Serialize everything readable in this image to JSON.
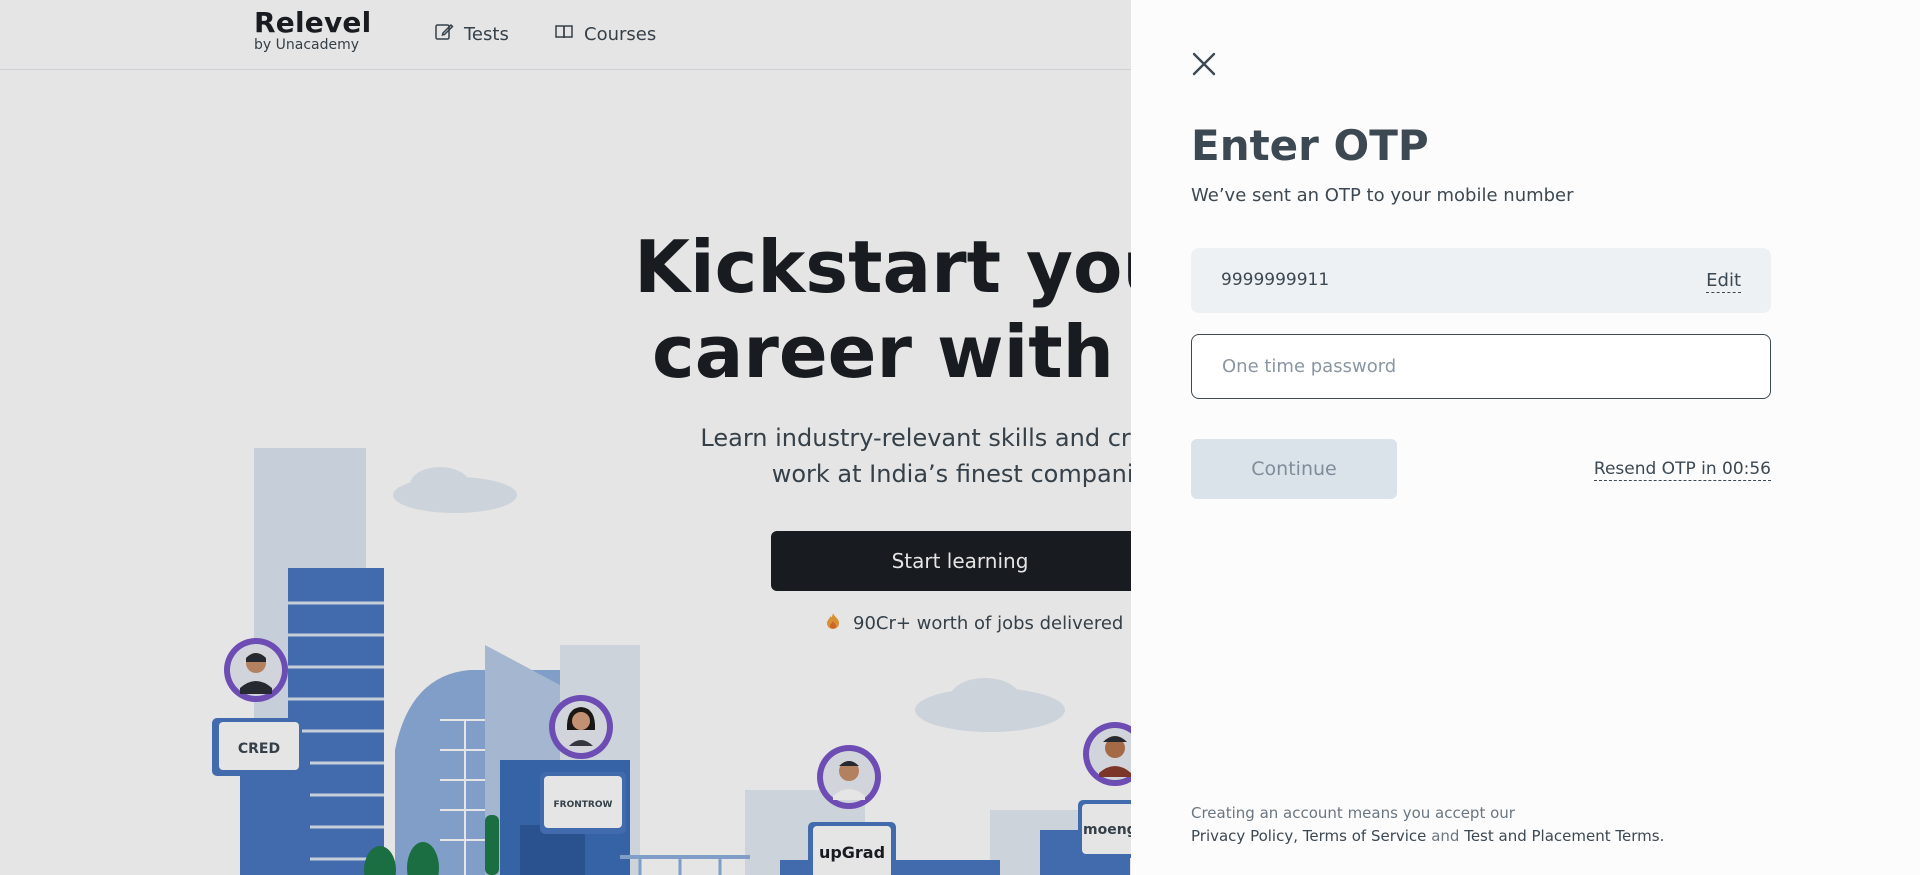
{
  "header": {
    "brand_name": "Relevel",
    "brand_sub": "by Unacademy",
    "nav": [
      {
        "label": "Tests",
        "icon": "edit-icon"
      },
      {
        "label": "Courses",
        "icon": "book-icon"
      }
    ]
  },
  "hero": {
    "title": "Kickstart your d\ncareer with Rel",
    "subtitle": "Learn industry-relevant skills and crack the\nwork at India’s finest companie",
    "cta_label": "Start learning",
    "stat_text": "90Cr+ worth of jobs delivered"
  },
  "illustration": {
    "company_logos": [
      "CRED",
      "FRONTROW",
      "upGrad",
      "moeng"
    ]
  },
  "drawer": {
    "title": "Enter OTP",
    "description": "We’ve sent an OTP to your mobile number",
    "phone_number": "9999999911",
    "edit_label": "Edit",
    "otp_placeholder": "One time password",
    "otp_value": "",
    "continue_label": "Continue",
    "resend_text": "Resend OTP in 00:56",
    "legal": {
      "prefix": "Creating an account means you accept our",
      "privacy": "Privacy Policy",
      "comma": ",",
      "terms": "Terms of Service",
      "and": "and",
      "placement": "Test and Placement Terms",
      "period": "."
    }
  },
  "colors": {
    "dark": "#1b1f24",
    "text": "#3c4852",
    "building_blue": "#4a78c2",
    "avatar_ring": "#7a56c9",
    "disabled_button": "#dbe3ea"
  }
}
